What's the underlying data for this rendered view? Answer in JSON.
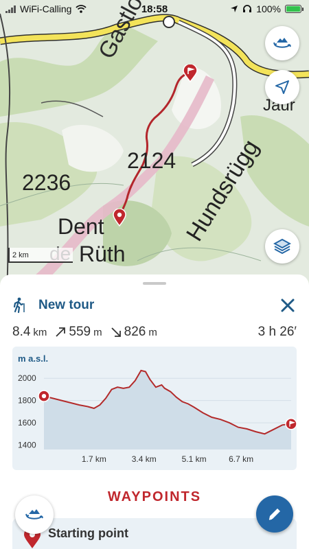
{
  "status": {
    "carrier": "WiFi-Calling",
    "time": "18:58",
    "battery": "100%"
  },
  "map": {
    "labels": {
      "peak1": "Gastlosen",
      "elev1": "2124",
      "elev2": "2236",
      "ridge": "Hundsrügg",
      "dent": "Dent",
      "ruth": "Rüth",
      "edge1": "de",
      "edge2": "Jaur"
    },
    "scale": "2 km"
  },
  "tour": {
    "title": "New tour",
    "distance": "8.4",
    "distance_unit": "km",
    "ascent": "559",
    "ascent_unit": "m",
    "descent": "826",
    "descent_unit": "m",
    "duration": "3 h 26′"
  },
  "profile": {
    "ylabel": "m a.s.l.",
    "yticks": [
      "2000",
      "1800",
      "1600",
      "1400"
    ],
    "xticks": [
      "1.7 km",
      "3.4 km",
      "5.1 km",
      "6.7 km"
    ]
  },
  "chart_data": {
    "type": "area",
    "ylabel": "m a.s.l.",
    "xlabel": "",
    "x": [
      0,
      0.3,
      0.6,
      0.9,
      1.2,
      1.5,
      1.7,
      1.9,
      2.1,
      2.3,
      2.5,
      2.7,
      2.9,
      3.1,
      3.3,
      3.45,
      3.6,
      3.8,
      4.0,
      4.1,
      4.3,
      4.5,
      4.7,
      4.9,
      5.1,
      5.4,
      5.7,
      6.0,
      6.3,
      6.6,
      6.9,
      7.2,
      7.5,
      7.8,
      8.1,
      8.4
    ],
    "y": [
      1840,
      1820,
      1800,
      1780,
      1760,
      1745,
      1730,
      1760,
      1820,
      1900,
      1920,
      1910,
      1920,
      1980,
      2070,
      2060,
      1990,
      1920,
      1940,
      1910,
      1880,
      1830,
      1790,
      1770,
      1740,
      1690,
      1650,
      1630,
      1600,
      1560,
      1545,
      1520,
      1500,
      1540,
      1580,
      1590
    ],
    "ylim": [
      1360,
      2100
    ],
    "xlim": [
      0,
      8.4
    ],
    "grid": true,
    "colors": {
      "line": "#b32a2a",
      "fill": "#cfdde8"
    }
  },
  "sections": {
    "waypoints_title": "WAYPOINTS",
    "first_waypoint": "Starting point"
  },
  "colors": {
    "accent": "#1f5a86",
    "red": "#c0272d",
    "fab": "#2467a6"
  }
}
